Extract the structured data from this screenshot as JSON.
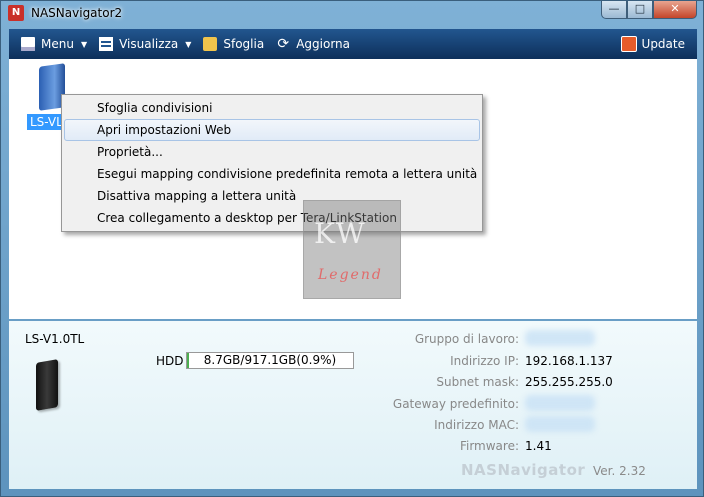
{
  "window": {
    "title": "NASNavigator2",
    "min": "—",
    "max": "□",
    "close": "✕"
  },
  "toolbar": {
    "menu": "Menu",
    "view": "Visualizza",
    "browse": "Sfoglia",
    "refresh": "Aggiorna",
    "update": "Update"
  },
  "device": {
    "label": "LS-VL"
  },
  "context_menu": {
    "items": [
      "Sfoglia condivisioni",
      "Apri impostazioni Web",
      "Proprietà...",
      "Esegui mapping condivisione predefinita remota a lettera unità",
      "Disattiva mapping a lettera unità",
      "Crea collegamento a desktop per Tera/LinkStation"
    ]
  },
  "watermark": {
    "top": "KW",
    "bottom": "Legend"
  },
  "details": {
    "name": "LS-V1.0TL",
    "hdd_label": "HDD",
    "hdd_usage": "8.7GB/917.1GB(0.9%)",
    "hdd_percent": 0.9,
    "rows": [
      {
        "label": "Gruppo di lavoro:",
        "value": ""
      },
      {
        "label": "Indirizzo IP:",
        "value": "192.168.1.137"
      },
      {
        "label": "Subnet mask:",
        "value": "255.255.255.0"
      },
      {
        "label": "Gateway predefinito:",
        "value": ""
      },
      {
        "label": "Indirizzo MAC:",
        "value": ""
      },
      {
        "label": "Firmware:",
        "value": "1.41"
      }
    ],
    "brand": "NASNavigator",
    "version": "Ver. 2.32"
  }
}
